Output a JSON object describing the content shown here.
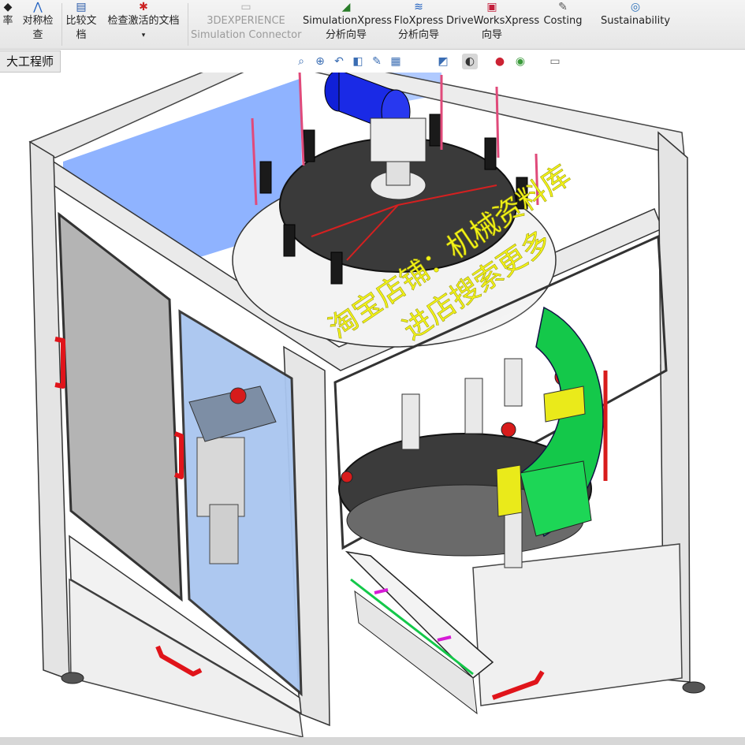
{
  "ribbon": {
    "items": [
      {
        "l1": "率",
        "l2": "",
        "icon": "reflectance-icon"
      },
      {
        "l1": "对称检",
        "l2": "查",
        "icon": "symmetry-check-icon"
      },
      {
        "l1": "比较文",
        "l2": "档",
        "icon": "compare-documents-icon"
      },
      {
        "l1": "检查激活的文档",
        "l2": "▾",
        "icon": "check-active-document-icon"
      },
      {
        "l1": "3DEXPERIENCE",
        "l2": "Simulation Connector",
        "icon": "3dexperience-icon"
      },
      {
        "l1": "SimulationXpress",
        "l2": "分析向导",
        "icon": "simulationxpress-icon"
      },
      {
        "l1": "FloXpress",
        "l2": "分析向导",
        "icon": "floxpress-icon"
      },
      {
        "l1": "DriveWorksXpress",
        "l2": "向导",
        "icon": "driveworksxpress-icon"
      },
      {
        "l1": "",
        "l2": "Costing",
        "icon": "costing-icon"
      },
      {
        "l1": "Sustainability",
        "l2": "",
        "icon": "sustainability-icon"
      }
    ]
  },
  "tabs": {
    "user_tab": "大工程师"
  },
  "view_toolbar": {
    "icons": [
      "zoom-to-fit-icon",
      "zoom-area-icon",
      "previous-view-icon",
      "section-view-icon",
      "dynamic-annotation-icon",
      "view-orientation-icon",
      "display-style-icon",
      "hide-show-items-icon",
      "edit-appearance-icon",
      "apply-scene-icon",
      "view-settings-icon"
    ]
  },
  "watermark": {
    "line1": "淘宝店铺：机械资料库",
    "line2": "进店搜索更多"
  },
  "colors": {
    "frame": "#e4e4e4",
    "glass_blue": "#8fb3ff",
    "handle": "#e0141a",
    "motor": "#1020d8",
    "guide_green": "#14c84a",
    "watermark": "#f3f318"
  }
}
